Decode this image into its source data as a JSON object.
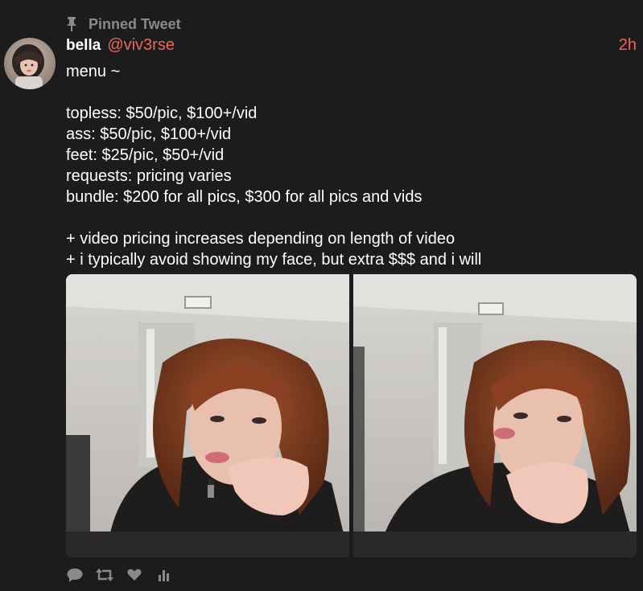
{
  "pinned": {
    "label": "Pinned Tweet",
    "icon": "pin-icon"
  },
  "author": {
    "name": "bella",
    "handle": "@viv3rse",
    "avatar": "avatar-photo"
  },
  "time": "2h",
  "body_lines": [
    "menu ~",
    "",
    "topless: $50/pic, $100+/vid",
    "ass: $50/pic, $100+/vid",
    "feet: $25/pic, $50+/vid",
    "requests: pricing varies",
    "bundle: $200 for all pics, $300 for all pics and vids",
    "",
    "+ video pricing increases depending on length of video",
    "+ i typically avoid showing my face, but extra $$$ and i will"
  ],
  "media": [
    {
      "alt": "photo-1"
    },
    {
      "alt": "photo-2"
    }
  ],
  "actions": [
    {
      "name": "reply",
      "icon": "reply-icon"
    },
    {
      "name": "retweet",
      "icon": "retweet-icon"
    },
    {
      "name": "like",
      "icon": "heart-icon"
    },
    {
      "name": "analytics",
      "icon": "analytics-icon"
    }
  ],
  "colors": {
    "background": "#1c1b1d",
    "accent": "#f0645a",
    "muted": "#8a8a8c",
    "text": "#ffffff"
  }
}
